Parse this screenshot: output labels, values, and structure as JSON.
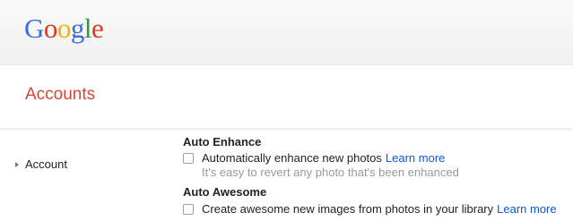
{
  "logo": {
    "letters": [
      {
        "char": "G",
        "color": "#3b6ed6"
      },
      {
        "char": "o",
        "color": "#d63a2a"
      },
      {
        "char": "o",
        "color": "#f0b400"
      },
      {
        "char": "g",
        "color": "#3b6ed6"
      },
      {
        "char": "l",
        "color": "#2e9b3b"
      },
      {
        "char": "e",
        "color": "#d63a2a"
      }
    ]
  },
  "header": {
    "title": "Accounts"
  },
  "sidebar": {
    "items": [
      {
        "label": "Account"
      }
    ]
  },
  "settings": {
    "auto_enhance": {
      "title": "Auto Enhance",
      "option_label": "Automatically enhance new photos",
      "link": "Learn more",
      "hint": "It's easy to revert any photo that's been enhanced",
      "checked": false
    },
    "auto_awesome": {
      "title": "Auto Awesome",
      "option_label": "Create awesome new images from photos in your library",
      "link": "Learn more",
      "checked": false
    }
  },
  "colors": {
    "accent_title": "#d14836",
    "link": "#1155cc",
    "hint": "#999999"
  }
}
